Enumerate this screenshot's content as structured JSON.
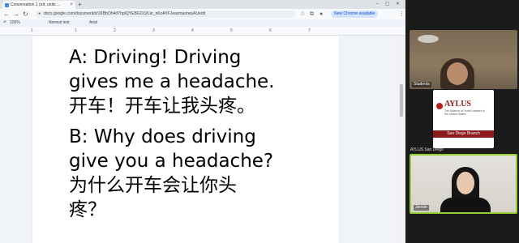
{
  "browser": {
    "tab_title": "Conversation 1 (ed. units ...",
    "tab_close": "×",
    "new_tab": "+",
    "window_controls": "– ▢ ✕",
    "nav": {
      "back": "←",
      "forward": "→",
      "reload": "↻"
    },
    "url": "docs.google.com/document/d/1KBbOh4d7hpIQYEBGOO/Lkr_nKoAYFJeaxmaoneyAUedit",
    "new_chrome_label": "New Chrome available",
    "menu": "⋮"
  },
  "docs_toolbar": {
    "zoom": "100%",
    "style": "Normal text",
    "font": "Arial"
  },
  "ruler": {
    "ticks": [
      "1",
      "1",
      "2",
      "3",
      "4",
      "5",
      "6",
      "7"
    ]
  },
  "document": {
    "lines": [
      "A: Driving! Driving",
      "gives me a headache.",
      "开车！开车让我头疼。",
      "B: Why does driving",
      "give you a headache?",
      "为什么开车会让你头",
      "疼？"
    ]
  },
  "video": {
    "participants": [
      {
        "name": "Students"
      },
      {
        "name": "AYLUS San Diego"
      },
      {
        "name": "Jennie"
      }
    ],
    "aylus": {
      "title": "AYLUS",
      "subtitle": "The Alliance of Youth Leaders in the United States",
      "branch": "San Diego Branch"
    }
  }
}
